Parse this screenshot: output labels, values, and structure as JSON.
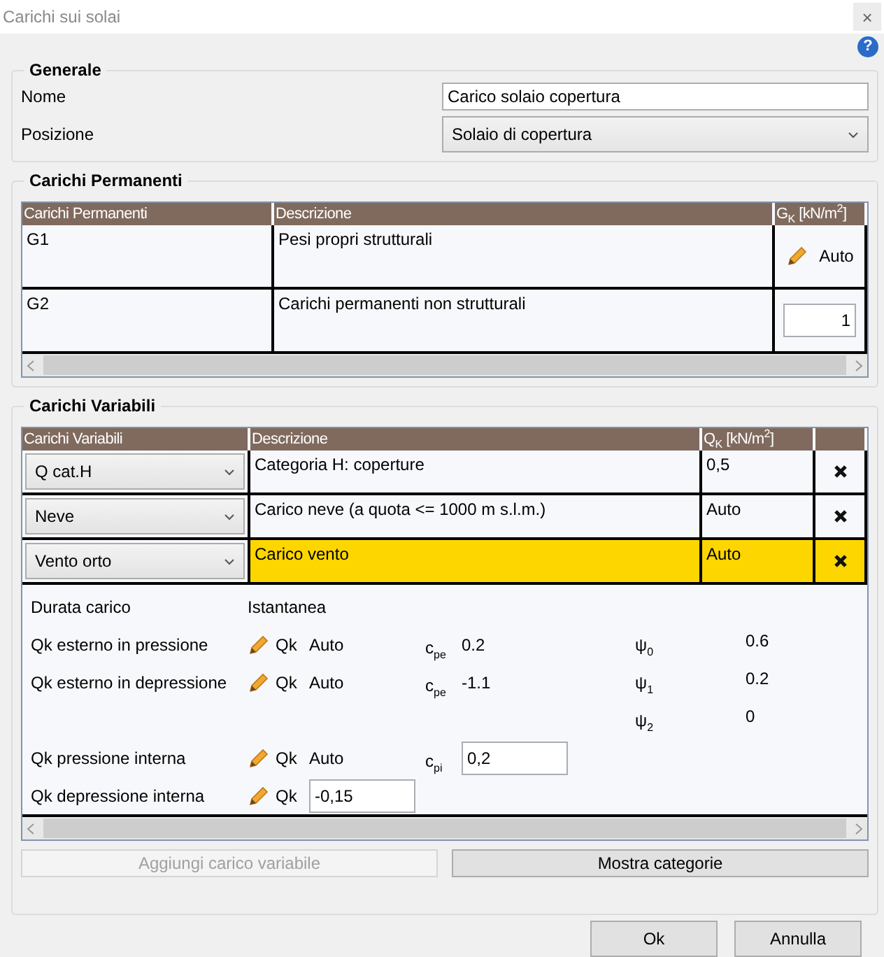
{
  "window": {
    "title": "Carichi sui solai",
    "close": "×",
    "help": "?"
  },
  "generale": {
    "title": "Generale",
    "fields": [
      {
        "label": "Nome",
        "value": "Carico solaio copertura",
        "kind": "input"
      },
      {
        "label": "Posizione",
        "value": "Solaio di copertura",
        "kind": "select"
      }
    ]
  },
  "permanenti": {
    "title": "Carichi Permanenti",
    "columns": [
      "Carichi Permanenti",
      "Descrizione",
      "G$_{K}$ [kN/m$^{2}$]"
    ],
    "rows": [
      {
        "name": "G1",
        "description": "Pesi propri strutturali",
        "value": "Auto",
        "kind": "auto"
      },
      {
        "name": "G2",
        "description": "Carichi permanenti non strutturali",
        "value": "1",
        "kind": "input"
      }
    ]
  },
  "variabili": {
    "title": "Carichi Variabili",
    "columns": [
      "Carichi Variabili",
      "Descrizione",
      "Q$_{K}$ [kN/m$^{2}$]",
      ""
    ],
    "rows": [
      {
        "type": "Q cat.H",
        "description": "Categoria H: coperture",
        "value": "0,5",
        "selected": false
      },
      {
        "type": "Neve",
        "description": "Carico neve (a quota <= 1000 m s.l.m.)",
        "value": "Auto",
        "selected": false
      },
      {
        "type": "Vento orto",
        "description": "Carico vento",
        "value": "Auto",
        "selected": true
      }
    ],
    "details": {
      "duration": {
        "label": "Durata carico",
        "value": "Istantanea"
      },
      "rows": [
        {
          "label": "Qk esterno in pressione",
          "qk": {
            "symbol": "Qk",
            "value": "Auto",
            "kind": "text"
          },
          "coef": {
            "symbol": "c$_{pe}$",
            "value": "0.2",
            "kind": "text"
          },
          "psi": {
            "symbol": "ψ$_{0}$",
            "value": "0.6"
          }
        },
        {
          "label": "Qk esterno in depressione",
          "qk": {
            "symbol": "Qk",
            "value": "Auto",
            "kind": "text"
          },
          "coef": {
            "symbol": "c$_{pe}$",
            "value": "-1.1",
            "kind": "text"
          },
          "psi": {
            "symbol": "ψ$_{1}$",
            "value": "0.2"
          }
        },
        {
          "psi": {
            "symbol": "ψ$_{2}$",
            "value": "0"
          }
        },
        {
          "label": "Qk pressione interna",
          "qk": {
            "symbol": "Qk",
            "value": "Auto",
            "kind": "text"
          },
          "coef": {
            "symbol": "c$_{pi}$",
            "value": "0,2",
            "kind": "input"
          }
        },
        {
          "label": "Qk depressione interna",
          "qk": {
            "symbol": "Qk",
            "value": "-0,15",
            "kind": "input"
          }
        }
      ]
    },
    "buttons": [
      {
        "label": "Aggiungi carico variabile",
        "disabled": true
      },
      {
        "label": "Mostra categorie",
        "disabled": false
      }
    ]
  },
  "footer": [
    "Ok",
    "Annulla"
  ]
}
